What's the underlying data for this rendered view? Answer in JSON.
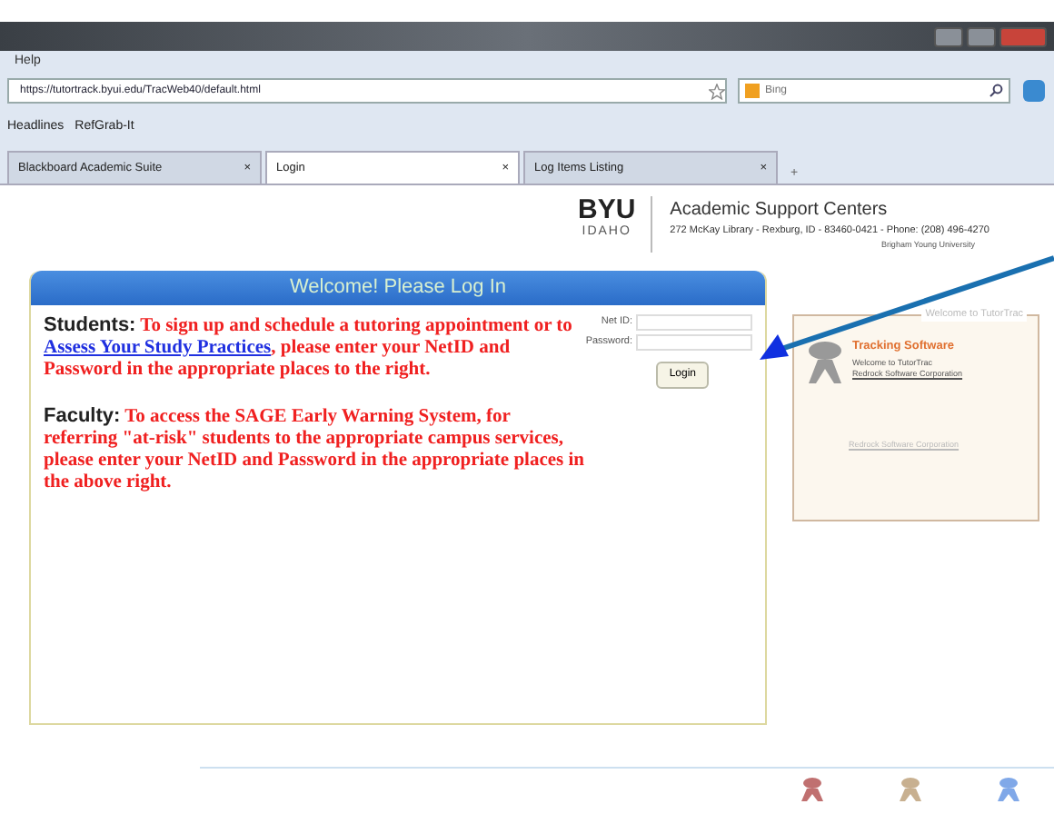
{
  "menu": [
    "Help"
  ],
  "address_bar": {
    "url": "https://tutortrack.byui.edu/TracWeb40/default.html"
  },
  "search": {
    "placeholder": "Bing"
  },
  "bookmarks": [
    "Headlines",
    "RefGrab-It"
  ],
  "tabs": [
    {
      "label": "Blackboard Academic Suite",
      "selected": false,
      "close": "×"
    },
    {
      "label": "Login",
      "selected": true,
      "close": "×"
    },
    {
      "label": "Log Items Listing",
      "selected": false,
      "close": "×"
    }
  ],
  "new_tab": "+",
  "header": {
    "logo_top": "BYU",
    "logo_bottom": "IDAHO",
    "title": "Academic Support Centers",
    "address": "272 McKay Library - Rexburg, ID - 83460-0421 - Phone: (208) 496-4270",
    "subtitle": "Brigham Young University"
  },
  "login_panel": {
    "title": "Welcome! Please Log In",
    "paragraphs": [
      {
        "lead": "Students:",
        "before": "To sign up and schedule a tutoring appointment or to",
        "link": "Assess Your Study Practices",
        "after": ", please enter your NetID and Password in the appropriate places to the right."
      },
      {
        "lead": "Faculty:",
        "before": "To access the SAGE Early Warning System, for referring \"at-risk\" students to the appropriate campus services, please enter your NetID and Password in the appropriate places in the above right."
      }
    ],
    "fields": [
      {
        "label": "Net ID:"
      },
      {
        "label": "Password:"
      }
    ],
    "button": "Login"
  },
  "info_box": {
    "legend": "Welcome to TutorTrac",
    "title": "Tracking Software",
    "text": "Welcome to TutorTrac",
    "link": "Redrock Software Corporation",
    "faded_link": "Redrock Software Corporation"
  },
  "footer_icons": [
    {
      "color": "#c07070"
    },
    {
      "color": "#c8b090"
    },
    {
      "color": "#80a8e8"
    }
  ]
}
